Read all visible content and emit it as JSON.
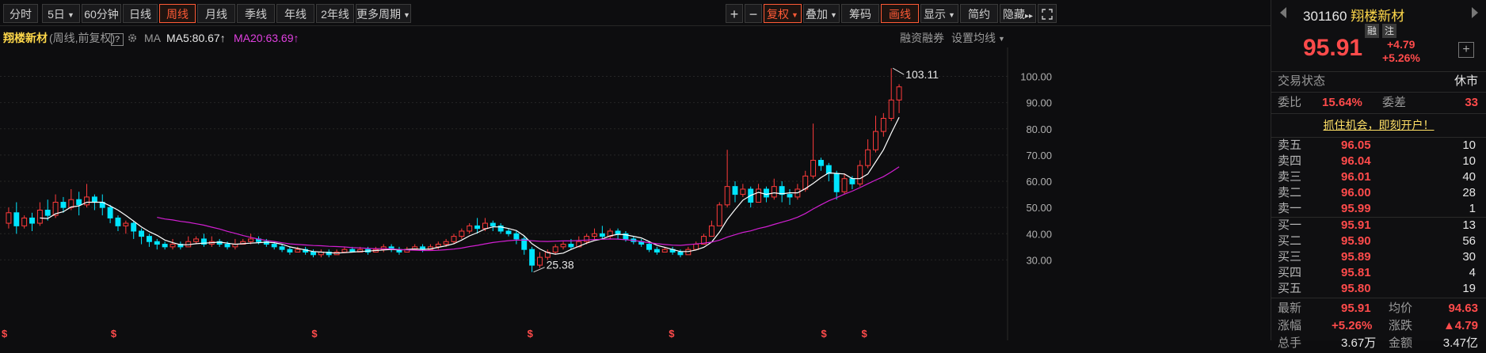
{
  "toolbar": {
    "periods": [
      "分时",
      "5日",
      "60分钟",
      "日线",
      "周线",
      "月线",
      "季线",
      "年线",
      "2年线",
      "更多周期"
    ],
    "active_period": "周线",
    "tools": [
      "复权",
      "叠加",
      "筹码",
      "画线",
      "显示",
      "简约",
      "隐藏"
    ],
    "plus": "+",
    "minus": "−",
    "hide_arrows": "▸▸"
  },
  "info": {
    "name": "翔楼新材",
    "mode": "(周线,前复权)",
    "help": "?",
    "ma_label": "MA",
    "ma5": "MA5:80.67",
    "ma20": "MA20:63.69",
    "up_arrow": "↑",
    "margin_link": "融资融券",
    "ma_settings": "设置均线"
  },
  "chart_data": {
    "type": "candlestick",
    "ylim": [
      25,
      108
    ],
    "yticks": [
      "100.00",
      "90.00",
      "80.00",
      "70.00",
      "60.00",
      "50.00",
      "40.00",
      "30.00"
    ],
    "ytick_values": [
      100,
      90,
      80,
      70,
      60,
      50,
      40,
      30
    ],
    "high_annotation": "103.11",
    "low_annotation": "25.38",
    "colors": {
      "up": "#ff3b3b",
      "down": "#00e5ff",
      "ma5": "#ffffff",
      "ma20": "#d21fd2",
      "grid": "#262626"
    },
    "candles": [
      [
        44,
        48,
        42,
        50
      ],
      [
        48,
        43,
        40,
        52
      ],
      [
        43,
        46,
        42,
        47
      ],
      [
        46,
        44,
        41,
        48
      ],
      [
        44,
        49,
        43,
        52
      ],
      [
        49,
        47,
        45,
        53
      ],
      [
        47,
        52,
        46,
        55
      ],
      [
        52,
        50,
        48,
        54
      ],
      [
        50,
        53,
        49,
        57
      ],
      [
        53,
        51,
        47,
        56
      ],
      [
        51,
        54,
        50,
        59
      ],
      [
        54,
        52,
        49,
        55
      ],
      [
        52,
        50,
        47,
        55
      ],
      [
        50,
        46,
        44,
        51
      ],
      [
        46,
        43,
        41,
        47
      ],
      [
        43,
        44,
        40,
        45
      ],
      [
        44,
        41,
        38,
        45
      ],
      [
        41,
        39,
        36,
        42
      ],
      [
        39,
        37,
        35,
        40
      ],
      [
        37,
        36,
        34,
        38
      ],
      [
        36,
        35,
        34,
        37
      ],
      [
        35,
        36,
        34,
        38
      ],
      [
        36,
        35,
        34,
        37
      ],
      [
        35,
        37,
        35,
        39
      ],
      [
        37,
        38,
        36,
        39
      ],
      [
        38,
        36,
        35,
        40
      ],
      [
        36,
        37,
        35,
        39
      ],
      [
        37,
        36,
        35,
        38
      ],
      [
        36,
        35,
        34,
        37
      ],
      [
        35,
        36,
        34,
        38
      ],
      [
        36,
        37,
        36,
        38
      ],
      [
        37,
        38,
        36,
        40
      ],
      [
        38,
        37,
        36,
        39
      ],
      [
        37,
        36,
        35,
        38
      ],
      [
        36,
        35,
        34,
        37
      ],
      [
        35,
        34,
        33,
        36
      ],
      [
        34,
        33,
        32,
        35
      ],
      [
        33,
        34,
        33,
        35
      ],
      [
        34,
        33,
        32,
        35
      ],
      [
        33,
        32,
        31,
        34
      ],
      [
        32,
        33,
        31,
        34
      ],
      [
        33,
        32,
        31,
        34
      ],
      [
        32,
        33,
        32,
        34
      ],
      [
        33,
        34,
        33,
        35
      ],
      [
        34,
        33,
        33,
        35
      ],
      [
        33,
        34,
        33,
        35
      ],
      [
        34,
        33,
        32,
        35
      ],
      [
        33,
        34,
        33,
        35
      ],
      [
        34,
        35,
        33,
        36
      ],
      [
        35,
        34,
        33,
        36
      ],
      [
        34,
        33,
        32,
        35
      ],
      [
        33,
        34,
        33,
        35
      ],
      [
        34,
        35,
        34,
        36
      ],
      [
        35,
        34,
        33,
        36
      ],
      [
        34,
        35,
        34,
        36
      ],
      [
        35,
        36,
        34,
        37
      ],
      [
        36,
        37,
        35,
        38
      ],
      [
        37,
        39,
        36,
        40
      ],
      [
        39,
        41,
        38,
        42
      ],
      [
        41,
        43,
        40,
        44
      ],
      [
        43,
        42,
        40,
        46
      ],
      [
        42,
        44,
        41,
        46
      ],
      [
        44,
        43,
        41,
        45
      ],
      [
        43,
        41,
        40,
        44
      ],
      [
        41,
        40,
        39,
        42
      ],
      [
        40,
        38,
        36,
        41
      ],
      [
        38,
        34,
        32,
        39
      ],
      [
        34,
        28,
        25.4,
        35
      ],
      [
        28,
        31,
        27,
        33
      ],
      [
        31,
        33,
        30,
        34
      ],
      [
        33,
        35,
        32,
        36
      ],
      [
        35,
        36,
        34,
        37
      ],
      [
        36,
        35,
        34,
        38
      ],
      [
        35,
        37,
        35,
        39
      ],
      [
        37,
        39,
        36,
        40
      ],
      [
        39,
        40,
        38,
        42
      ],
      [
        40,
        39,
        38,
        43
      ],
      [
        39,
        41,
        38,
        42
      ],
      [
        41,
        40,
        38,
        42
      ],
      [
        40,
        38,
        37,
        41
      ],
      [
        38,
        37,
        36,
        39
      ],
      [
        37,
        36,
        35,
        38
      ],
      [
        36,
        34,
        33,
        37
      ],
      [
        34,
        33,
        32,
        35
      ],
      [
        33,
        34,
        33,
        35
      ],
      [
        34,
        33,
        32,
        35
      ],
      [
        33,
        32,
        31,
        34
      ],
      [
        32,
        34,
        32,
        35
      ],
      [
        34,
        36,
        34,
        37
      ],
      [
        36,
        39,
        36,
        40
      ],
      [
        39,
        43,
        39,
        45
      ],
      [
        43,
        51,
        43,
        52
      ],
      [
        51,
        58,
        50,
        72
      ],
      [
        58,
        55,
        52,
        60
      ],
      [
        55,
        57,
        54,
        59
      ],
      [
        57,
        52,
        50,
        58
      ],
      [
        52,
        57,
        52,
        59
      ],
      [
        57,
        54,
        52,
        58
      ],
      [
        54,
        58,
        53,
        61
      ],
      [
        58,
        55,
        52,
        60
      ],
      [
        55,
        54,
        51,
        57
      ],
      [
        54,
        57,
        53,
        59
      ],
      [
        57,
        62,
        56,
        64
      ],
      [
        62,
        68,
        61,
        82
      ],
      [
        68,
        66,
        64,
        69
      ],
      [
        66,
        63,
        60,
        67
      ],
      [
        63,
        56,
        53,
        64
      ],
      [
        56,
        61,
        55,
        63
      ],
      [
        61,
        59,
        57,
        62
      ],
      [
        59,
        66,
        58,
        68
      ],
      [
        66,
        72,
        65,
        76
      ],
      [
        72,
        79,
        71,
        85
      ],
      [
        79,
        84,
        77,
        86
      ],
      [
        84,
        91,
        83,
        103.1
      ],
      [
        91,
        96,
        86,
        97
      ]
    ]
  },
  "panel": {
    "code": "301160",
    "name": "翔楼新材",
    "badges": [
      "融",
      "注"
    ],
    "price": "95.91",
    "change": "+4.79",
    "change_pct": "+5.26%",
    "status_label": "交易状态",
    "status_value": "休市",
    "weibi_label": "委比",
    "weibi_value": "15.64%",
    "weicha_label": "委差",
    "weicha_value": "33",
    "promo": "抓住机会，即刻开户！",
    "asks": [
      {
        "label": "卖五",
        "price": "96.05",
        "vol": "10"
      },
      {
        "label": "卖四",
        "price": "96.04",
        "vol": "10"
      },
      {
        "label": "卖三",
        "price": "96.01",
        "vol": "40"
      },
      {
        "label": "卖二",
        "price": "96.00",
        "vol": "28"
      },
      {
        "label": "卖一",
        "price": "95.99",
        "vol": "1"
      }
    ],
    "bids": [
      {
        "label": "买一",
        "price": "95.91",
        "vol": "13"
      },
      {
        "label": "买二",
        "price": "95.90",
        "vol": "56"
      },
      {
        "label": "买三",
        "price": "95.89",
        "vol": "30"
      },
      {
        "label": "买四",
        "price": "95.81",
        "vol": "4"
      },
      {
        "label": "买五",
        "price": "95.80",
        "vol": "19"
      }
    ],
    "stats": {
      "latest_label": "最新",
      "latest": "95.91",
      "avg_label": "均价",
      "avg": "94.63",
      "pct_label": "涨幅",
      "pct": "+5.26%",
      "chg_label": "涨跌",
      "chg": "▲4.79",
      "total_label": "总手",
      "total": "3.67万",
      "amount_label": "金额",
      "amount": "3.47亿"
    }
  }
}
